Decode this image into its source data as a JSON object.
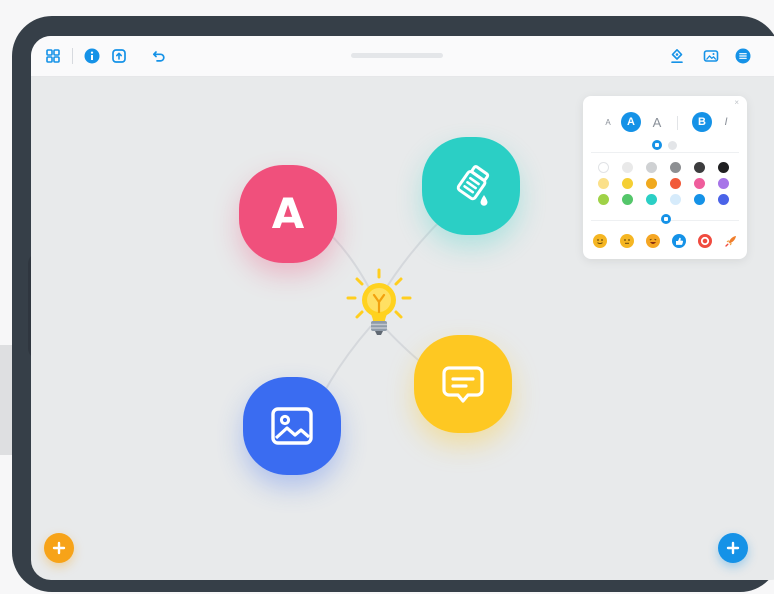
{
  "toolbar": {
    "left_icons": [
      "grid-icon",
      "info-icon",
      "export-icon",
      "undo-icon"
    ],
    "right_icons": [
      "style-icon",
      "image-icon",
      "menu-icon"
    ],
    "accent": "#1592e7"
  },
  "mindmap": {
    "center": {
      "icon": "lightbulb-icon",
      "color": "#ffd21f"
    },
    "branches": [
      {
        "id": "text",
        "label": "A",
        "icon": "letter-a-icon",
        "color": "#f0507c"
      },
      {
        "id": "paint",
        "icon": "paint-bucket-icon",
        "color": "#2bcfc5"
      },
      {
        "id": "image",
        "icon": "image-icon",
        "color": "#3a6cf1"
      },
      {
        "id": "comment",
        "icon": "comment-icon",
        "color": "#fec822"
      }
    ]
  },
  "style_panel": {
    "font_options": [
      {
        "label": "A",
        "role": "small-font"
      },
      {
        "label": "A",
        "role": "medium-font",
        "active": true
      },
      {
        "label": "A",
        "role": "large-font"
      },
      {
        "label": "B",
        "role": "bold",
        "active": true
      },
      {
        "label": "I",
        "role": "italic"
      }
    ],
    "colors": [
      [
        "#ffffff",
        "#e9e9e9",
        "#cfd1d3",
        "#8d8f92",
        "#3c3c3e",
        "#1f1f21"
      ],
      [
        "#fbe08a",
        "#f5cf34",
        "#f0a91e",
        "#f15a3a",
        "#ef5d9c",
        "#a774e8"
      ],
      [
        "#9fd247",
        "#54c66a",
        "#2bcfc5",
        "#d6ebfb",
        "#1592e7",
        "#4a63e8"
      ]
    ],
    "emojis": [
      {
        "icon": "smile-emoji-icon",
        "color": "#f5b623"
      },
      {
        "icon": "neutral-emoji-icon",
        "color": "#f5b623"
      },
      {
        "icon": "laugh-emoji-icon",
        "color": "#f5a623"
      },
      {
        "icon": "thumbs-up-icon",
        "color": "#1592e7"
      },
      {
        "icon": "ring-icon",
        "color": "#f04b3f"
      },
      {
        "icon": "rocket-icon",
        "color": "#f07e2c"
      }
    ]
  },
  "fabs": {
    "left": {
      "icon": "plus-icon",
      "color": "#f7a318"
    },
    "right": {
      "icon": "plus-icon",
      "color": "#1592e7"
    }
  }
}
